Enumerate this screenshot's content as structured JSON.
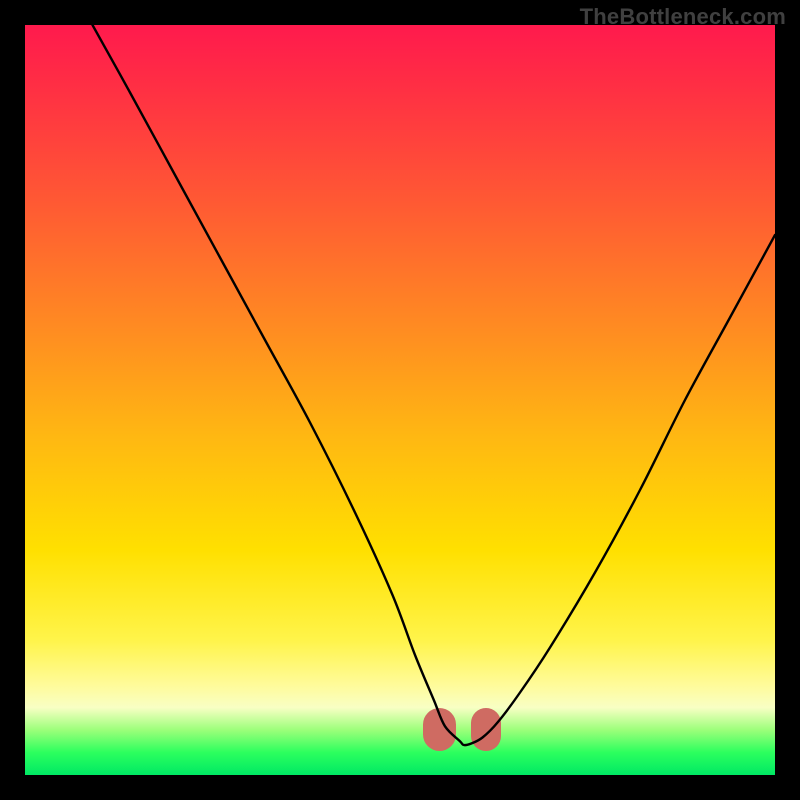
{
  "watermark": "TheBottleneck.com",
  "colors": {
    "frame": "#000000",
    "watermark_text": "#404040",
    "curve": "#000000",
    "blob": "#cf6b62",
    "gradient_stops": [
      "#ff1a4d",
      "#ff5a33",
      "#ffb812",
      "#fff44a",
      "#2cff5e",
      "#00e864"
    ]
  },
  "chart_data": {
    "type": "line",
    "title": "",
    "xlabel": "",
    "ylabel": "",
    "xlim": [
      0,
      100
    ],
    "ylim": [
      0,
      100
    ],
    "grid": false,
    "legend": false,
    "series": [
      {
        "name": "curve",
        "x": [
          9,
          14,
          20,
          26,
          32,
          38,
          44,
          49,
          52,
          54.5,
          56,
          58,
          58.5,
          59.5,
          61,
          63,
          66,
          70,
          76,
          82,
          88,
          94,
          100
        ],
        "y": [
          100,
          91,
          80,
          69,
          58,
          47,
          35,
          24,
          16,
          10,
          6.5,
          4.5,
          4,
          4.2,
          5,
          7,
          11,
          17,
          27,
          38,
          50,
          61,
          72
        ]
      }
    ],
    "annotations": [
      {
        "name": "valley-blob-left",
        "x_range": [
          53,
          57.5
        ],
        "y_range": [
          3.2,
          9
        ]
      },
      {
        "name": "valley-blob-right",
        "x_range": [
          59.5,
          63.5
        ],
        "y_range": [
          3.2,
          9
        ]
      }
    ]
  }
}
